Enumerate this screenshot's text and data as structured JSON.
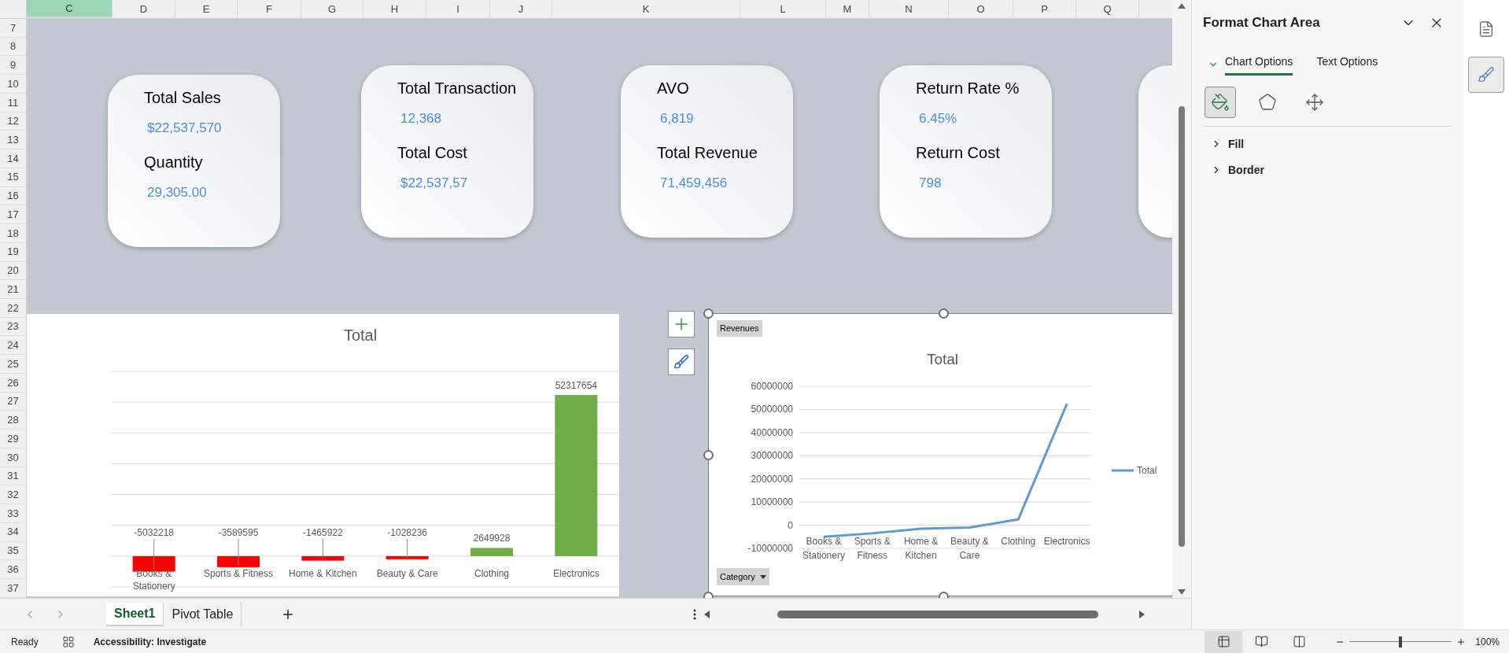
{
  "column_headers": [
    {
      "label": "C",
      "selected": true
    },
    {
      "label": "D",
      "selected": false
    },
    {
      "label": "E",
      "selected": false
    },
    {
      "label": "F",
      "selected": false
    },
    {
      "label": "G",
      "selected": false
    },
    {
      "label": "H",
      "selected": false
    },
    {
      "label": "I",
      "selected": false
    },
    {
      "label": "J",
      "selected": false
    },
    {
      "label": "K",
      "selected": false
    },
    {
      "label": "L",
      "selected": false
    },
    {
      "label": "M",
      "selected": false
    },
    {
      "label": "N",
      "selected": false
    },
    {
      "label": "O",
      "selected": false
    },
    {
      "label": "P",
      "selected": false
    },
    {
      "label": "Q",
      "selected": false
    }
  ],
  "row_headers": [
    "7",
    "8",
    "9",
    "10",
    "11",
    "12",
    "13",
    "14",
    "15",
    "16",
    "17",
    "18",
    "19",
    "20",
    "21",
    "22",
    "23",
    "24",
    "25",
    "26",
    "27",
    "28",
    "29",
    "30",
    "31",
    "32",
    "33",
    "34",
    "35",
    "36",
    "37"
  ],
  "kpi_cards": [
    {
      "kind": "full",
      "metrics": [
        {
          "label": "Total Sales",
          "value": "$22,537,570"
        },
        {
          "label": "Quantity",
          "value": "29,305.00"
        }
      ]
    },
    {
      "kind": "full",
      "metrics": [
        {
          "label": "Total Transaction",
          "value": "12,368"
        },
        {
          "label": "Total Cost",
          "value": "$22,537,57"
        }
      ]
    },
    {
      "kind": "full",
      "metrics": [
        {
          "label": "AVO",
          "value": "6,819"
        },
        {
          "label": "Total Revenue",
          "value": "71,459,456"
        }
      ]
    },
    {
      "kind": "full",
      "metrics": [
        {
          "label": "Return Rate %",
          "value": "6.45%"
        },
        {
          "label": "Return Cost",
          "value": "798"
        }
      ]
    },
    {
      "kind": "clipped"
    }
  ],
  "bar_chart": {
    "chart_data": {
      "type": "bar",
      "title": "Total",
      "categories": [
        "Books & Stationery",
        "Sports & Fitness",
        "Home & Kitchen",
        "Beauty & Care",
        "Clothing",
        "Electronics"
      ],
      "data_labels": true,
      "grid": true,
      "series": [
        {
          "colors": [
            "#ff0000",
            "#ff0000",
            "#ff0000",
            "#ff0000",
            "#70ad47",
            "#70ad47"
          ],
          "values": [
            -5032218,
            -3589595,
            -1465922,
            -1028236,
            2649928,
            52317654
          ]
        }
      ]
    }
  },
  "line_chart": {
    "value_field_button": "Revenues",
    "axis_field_button": "Category",
    "chart_data": {
      "type": "line",
      "title": "Total",
      "categories": [
        "Books & Stationery",
        "Sports & Fitness",
        "Home & Kitchen",
        "Beauty & Care",
        "Clothing",
        "Electronics"
      ],
      "ylim": [
        -10000000,
        60000000
      ],
      "grid": true,
      "yticks": [
        -10000000,
        0,
        10000000,
        20000000,
        30000000,
        40000000,
        50000000,
        60000000
      ],
      "series": [
        {
          "name": "Total",
          "color": "#5b9bd5",
          "values": [
            -5000000,
            -3500000,
            -1500000,
            -1000000,
            2500000,
            52500000
          ]
        }
      ]
    }
  },
  "format_panel": {
    "title": "Format Chart Area",
    "tabs": [
      {
        "label": "Chart Options",
        "selected": true
      },
      {
        "label": "Text Options",
        "selected": false
      }
    ],
    "icon_tabs": [
      {
        "kind": "fill",
        "selected": true
      },
      {
        "kind": "effects",
        "selected": false
      },
      {
        "kind": "size",
        "selected": false
      }
    ],
    "sections": [
      {
        "label": "Fill",
        "expanded": false
      },
      {
        "label": "Border",
        "expanded": false
      }
    ],
    "side_buttons": [
      {
        "kind": "properties",
        "selected": false
      },
      {
        "kind": "format",
        "selected": true
      }
    ]
  },
  "sheet_tabs": [
    {
      "label": "Sheet1",
      "selected": true
    },
    {
      "label": "Pivot Table",
      "selected": false
    }
  ],
  "status_bar": {
    "status": "Ready",
    "accessibility": "Accessibility: Investigate",
    "views": [
      {
        "kind": "normal",
        "selected": true
      },
      {
        "kind": "page_layout",
        "selected": false
      },
      {
        "kind": "page_break",
        "selected": false
      }
    ],
    "zoom": {
      "level": 0.5,
      "reading": "100%"
    }
  }
}
